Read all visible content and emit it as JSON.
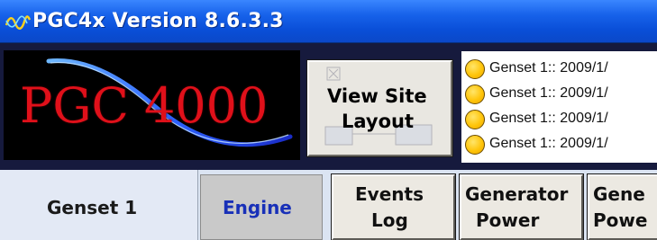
{
  "window": {
    "title": "PGC4x Version 8.6.3.3",
    "icon": "sine-wave-icon"
  },
  "logo": {
    "text": "PGC 4000"
  },
  "view_site_button": {
    "line1": "View Site",
    "line2": "Layout",
    "icon": "site-layout-icon"
  },
  "events": [
    {
      "text": "Genset 1:: 2009/1/",
      "status_color": "#ffc50a"
    },
    {
      "text": "Genset 1:: 2009/1/",
      "status_color": "#ffc50a"
    },
    {
      "text": "Genset 1:: 2009/1/",
      "status_color": "#ffc50a"
    },
    {
      "text": "Genset 1:: 2009/1/",
      "status_color": "#ffc50a"
    }
  ],
  "tabs": {
    "genset": "Genset 1",
    "engine": "Engine"
  },
  "nav_buttons": {
    "events_log": {
      "line1": "Events",
      "line2": "Log"
    },
    "generator_power": {
      "line1": "Generator",
      "line2": "Power"
    },
    "generator_power_2": {
      "line1": "Gene",
      "line2": "Powe"
    }
  },
  "colors": {
    "title_bar": "#0a4fd8",
    "logo_text": "#e0101a",
    "engine_tab_text": "#1830b8",
    "event_indicator": "#ffc50a"
  }
}
